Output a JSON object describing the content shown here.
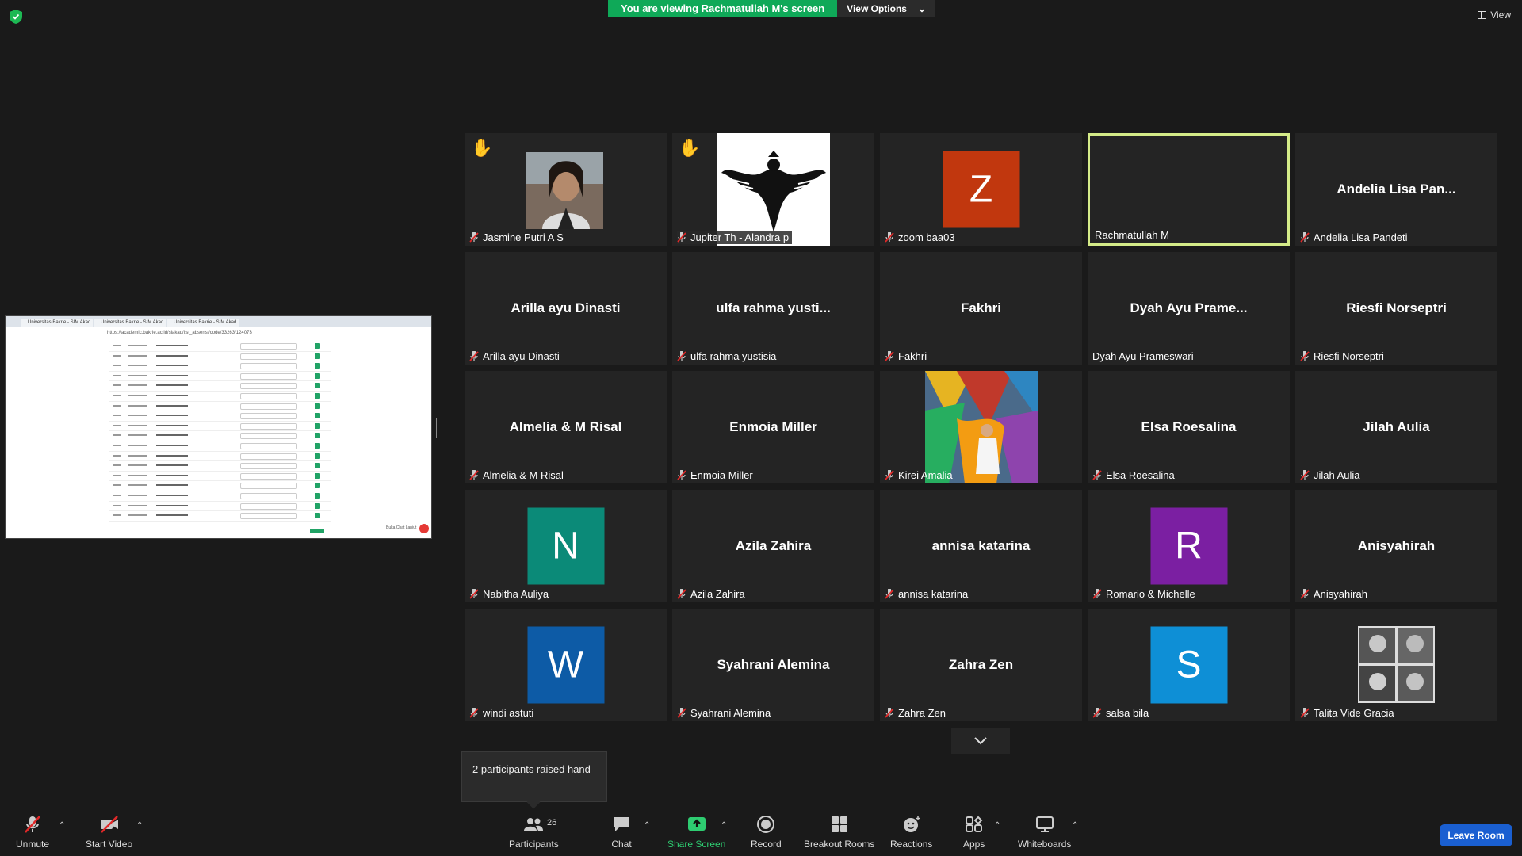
{
  "banner": {
    "viewing_text": "You are viewing Rachmatullah M's screen",
    "view_options_label": "View Options"
  },
  "top_right": {
    "view_label": "View"
  },
  "shared_screen": {
    "tabs": [
      "Universitas Bakrie - SIM Akad...",
      "Universitas Bakrie - SIM Akad...",
      "Universitas Bakrie - SIM Akad..."
    ],
    "url": "https://academic.bakrie.ac.id/siakad/list_absensi/code/33263/124073",
    "chat_text": "Buka Chat Lanjut"
  },
  "tiles": [
    {
      "name": "Jasmine Putri A S",
      "type": "photo-woman",
      "hand": true,
      "muted": true
    },
    {
      "name": "Jupiter Th - Alandra p",
      "type": "photo-eagle",
      "hand": true,
      "muted": true,
      "boxed": true
    },
    {
      "name": "zoom baa03",
      "type": "avatar",
      "letter": "Z",
      "color": "#c1370e",
      "muted": true
    },
    {
      "name": "Rachmatullah M",
      "type": "active",
      "muted": false
    },
    {
      "name": "Andelia Lisa Pandeti",
      "big": "Andelia Lisa Pan...",
      "type": "text",
      "muted": true
    },
    {
      "name": "Arilla ayu Dinasti",
      "big": "Arilla ayu Dinasti",
      "type": "text",
      "muted": true
    },
    {
      "name": "ulfa rahma yustisia",
      "big": "ulfa rahma yusti...",
      "type": "text",
      "muted": true
    },
    {
      "name": "Fakhri",
      "big": "Fakhri",
      "type": "text",
      "muted": true
    },
    {
      "name": "Dyah Ayu Prameswari",
      "big": "Dyah Ayu Prame...",
      "type": "text",
      "muted": false
    },
    {
      "name": "Riesfi Norseptri",
      "big": "Riesfi Norseptri",
      "type": "text",
      "muted": true
    },
    {
      "name": "Almelia & M Risal",
      "big": "Almelia & M Risal",
      "type": "text",
      "muted": true
    },
    {
      "name": "Enmoia Miller",
      "big": "Enmoia Miller",
      "type": "text",
      "muted": true
    },
    {
      "name": "Kirei Amalia",
      "type": "photo-art",
      "muted": true
    },
    {
      "name": "Elsa Roesalina",
      "big": "Elsa Roesalina",
      "type": "text",
      "muted": true
    },
    {
      "name": "Jilah Aulia",
      "big": "Jilah Aulia",
      "type": "text",
      "muted": true
    },
    {
      "name": "Nabitha Auliya",
      "type": "avatar",
      "letter": "N",
      "color": "#0b8a78",
      "muted": true
    },
    {
      "name": "Azila Zahira",
      "big": "Azila Zahira",
      "type": "text",
      "muted": true
    },
    {
      "name": "annisa katarina",
      "big": "annisa katarina",
      "type": "text",
      "muted": true
    },
    {
      "name": "Romario & Michelle",
      "type": "avatar",
      "letter": "R",
      "color": "#7b1fa2",
      "muted": true
    },
    {
      "name": "Anisyahirah",
      "big": "Anisyahirah",
      "type": "text",
      "muted": true
    },
    {
      "name": "windi astuti",
      "type": "avatar",
      "letter": "W",
      "color": "#0d5ba6",
      "muted": true
    },
    {
      "name": "Syahrani Alemina",
      "big": "Syahrani Alemina",
      "type": "text",
      "muted": true
    },
    {
      "name": "Zahra Zen",
      "big": "Zahra Zen",
      "type": "text",
      "muted": true
    },
    {
      "name": "salsa bila",
      "type": "avatar",
      "letter": "S",
      "color": "#0e8fd6",
      "muted": true
    },
    {
      "name": "Talita Vide Gracia",
      "type": "photo-bw",
      "muted": true
    }
  ],
  "tooltip": {
    "text": "2 participants raised hand"
  },
  "toolbar": {
    "unmute": "Unmute",
    "start_video": "Start Video",
    "participants": "Participants",
    "participants_count": "26",
    "chat": "Chat",
    "share_screen": "Share Screen",
    "record": "Record",
    "breakout_rooms": "Breakout Rooms",
    "reactions": "Reactions",
    "apps": "Apps",
    "whiteboards": "Whiteboards",
    "leave": "Leave Room"
  },
  "colors": {
    "accent_green": "#0fa958",
    "active_border": "#d4eb88",
    "leave_blue": "#1a5fd1",
    "mute_red": "#e02828"
  }
}
